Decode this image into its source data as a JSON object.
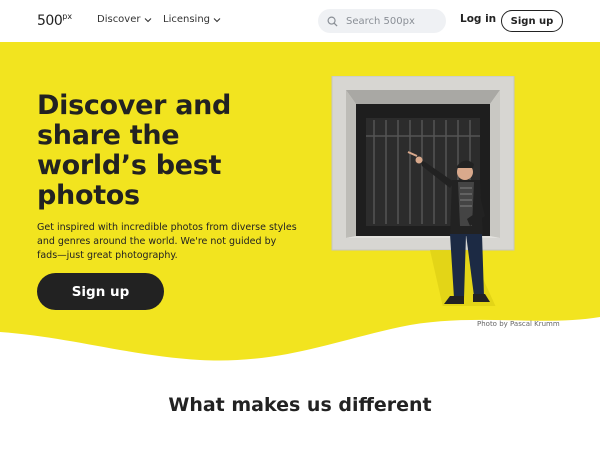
{
  "header": {
    "logo_text": "500",
    "logo_sup": "px",
    "nav": [
      {
        "label": "Discover"
      },
      {
        "label": "Licensing"
      }
    ],
    "search_placeholder": "Search 500px",
    "login_label": "Log in",
    "signup_label": "Sign up"
  },
  "hero": {
    "title": "Discover and share the world’s best photos",
    "subtitle": "Get inspired with incredible photos from diverse styles and genres around the world. We're not guided by fads—just great photography.",
    "cta_label": "Sign up",
    "photo_credit": "Photo by Pascal Krumm"
  },
  "section": {
    "title": "What makes us different"
  },
  "colors": {
    "hero_yellow": "#f2e41f",
    "dark": "#222222"
  }
}
